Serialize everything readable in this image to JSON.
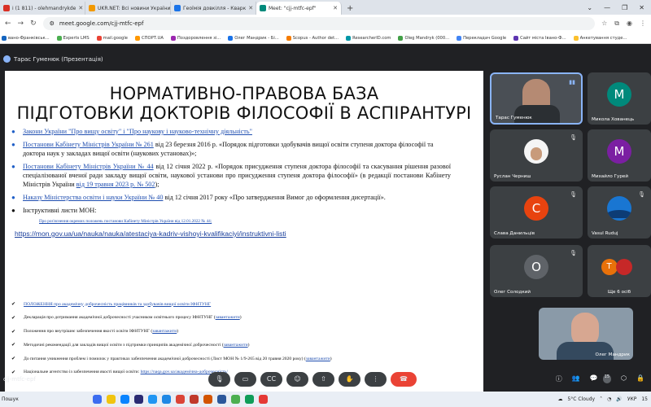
{
  "tabs": [
    {
      "label": "і (1 811) - olehmandrykde",
      "color": "#d93025",
      "active": false
    },
    {
      "label": "UKR.NET: Всі новини України",
      "color": "#f29900",
      "active": false
    },
    {
      "label": "Геоїмія довкілля - Кварк",
      "color": "#1a73e8",
      "active": false
    },
    {
      "label": "Meet: \"cjj-mtfc-epf\"",
      "color": "#00897b",
      "active": true
    }
  ],
  "addressbar": {
    "url": "meet.google.com/cjj-mtfc-epf"
  },
  "bookmarks": [
    "вано-Франківськ...",
    "Experts LMS",
    "mail.google",
    "СПОРТ.UA",
    "Поздоровлення зі...",
    "Олег Мандрик - Бі...",
    "Scopus - Author det...",
    "ResearcherID.com",
    "Oleg Mandryk (000...",
    "Перекладач Google",
    "Сайт міста Івано-Ф...",
    "Анкетування студе..."
  ],
  "presenter": "Тарас Гуменюк (Презентація)",
  "slide": {
    "title_line1": "НОРМАТИВНО-ПРАВОВА БАЗА",
    "title_line2": "ПІДГОТОВКИ ДОКТОРІВ ФІЛОСОФІЇ В АСПІРАНТУРІ",
    "item1": "Закони України \"Про вищу освіту\" і \"Про наукову і науково-технічну діяльність\"",
    "item2_link": "Постанови Кабінету Міністрів України № 261",
    "item2_text": " від 23 березня 2016 р. «Порядок підготовки здобувачів вищої освіти ступеня доктора філософії та доктора наук у закладах вищої освіти (наукових установах)»;",
    "item3_link": "Постанови Кабінету Міністрів України № 44",
    "item3_text": " від 12 січня 2022 р. «Порядок присудження ступеня доктора філософії та скасування рішення разової спеціалізованої вченої ради закладу вищої освіти, наукової установи про присудження ступеня доктора філософії» (в редакції постанови Кабінету Міністрів України ",
    "item3_link2": "від 19 травня 2023 р. № 502",
    "item3_end": ");",
    "item4_link": "Наказу Міністерства освіти і науки України № 40",
    "item4_text": " від 12 січня 2017 року «Про затвердження Вимог до оформлення дисертації».",
    "item5": "Інструктивні листи МОН:",
    "item5_sub": "Про роз'яснення окремих положень постанови Кабінету Міністрів України від 12.01.2022 № 44;",
    "url": "https://mon.gov.ua/ua/nauka/nauka/atestaciya-kadriv-vishoyi-kvalifikaciyi/instruktivni-listi",
    "check1_link": "ПОЛОЖЕННЯ про академічну доброчесність працівників та здобувачів вищої освіти ІФНТУНГ",
    "check2_text": "Декларація про дотримання академічної доброчесності учасником освітнього процесу ІФНТУНГ (",
    "check2_link": "завантажити",
    "check3_text": "Положення про внутрішнє забезпечення якості освіти ІФНТУНГ (",
    "check3_link": "завантажити",
    "check4_text": "Методичні рекомендації для закладів вищої освіти з підтримки принципів академічної доброчесності (",
    "check4_link": "завантажити",
    "check5_text": "До питання уникнення проблем і помилок у практиках забезпечення академічної доброчесності (Лист МОН № 1/9-265 від 20 травня 2020 року) (",
    "check5_link": "завантажити",
    "check6_text": "Національне агентство із забезпечення якості вищої освіти: ",
    "check6_link": "https://naqa.gov.ua/академічна-доброчесність/",
    "close_paren": ")"
  },
  "participants": [
    {
      "name": "Тарас Гуменюк",
      "type": "video"
    },
    {
      "name": "Микола Хованець",
      "initial": "М",
      "color": "#00897b"
    },
    {
      "name": "Руслан Черниш",
      "type": "photo"
    },
    {
      "name": "Михайло Гурей",
      "initial": "M",
      "color": "#7b1fa2"
    },
    {
      "name": "Слава Данильців",
      "initial": "С",
      "color": "#e8430f"
    },
    {
      "name": "Vasul Ruduj",
      "type": "photo"
    },
    {
      "name": "Олег Солодкий",
      "initial": "О",
      "color": "#5f6368"
    },
    {
      "name": "Ще 6 осіб",
      "initial": "T",
      "color": "#e8710a"
    },
    {
      "name": "Олег Мандрик",
      "type": "video"
    }
  ],
  "meet_code": "cjj-mtfc-epf",
  "chat_badge": "15",
  "taskbar": {
    "search": "Пошук",
    "weather": "5°C  Cloudy",
    "lang": "УКР",
    "clock": "15"
  }
}
